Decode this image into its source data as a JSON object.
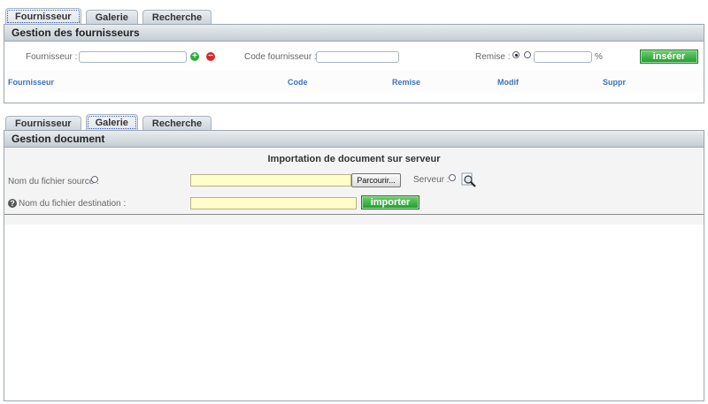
{
  "top": {
    "tabs": [
      "Fournisseur",
      "Galerie",
      "Recherche"
    ],
    "panel_title": "Gestion des fournisseurs",
    "fournisseur_label": "Fournisseur :",
    "code_label": "Code fournisseur :",
    "remise_label": "Remise :",
    "percent": "%",
    "insert_label": "insérer",
    "columns": [
      "Fournisseur",
      "Code",
      "Remise",
      "Modif",
      "Suppr"
    ]
  },
  "bottom": {
    "tabs": [
      "Fournisseur",
      "Galerie",
      "Recherche"
    ],
    "panel_title": "Gestion document",
    "heading": "Importation de document sur serveur",
    "source_label": "Nom du fichier source :",
    "browse_label": "Parcourir...",
    "server_label": "Serveur :",
    "dest_label": "Nom du fichier destination :",
    "import_label": "importer"
  },
  "colors": {
    "accent_green": "#1e9a2e",
    "link_blue": "#3c72c4",
    "yellow_field": "#fffdc8"
  },
  "icons": [
    "add-icon",
    "remove-icon",
    "search-magnifier-icon",
    "help-icon"
  ]
}
